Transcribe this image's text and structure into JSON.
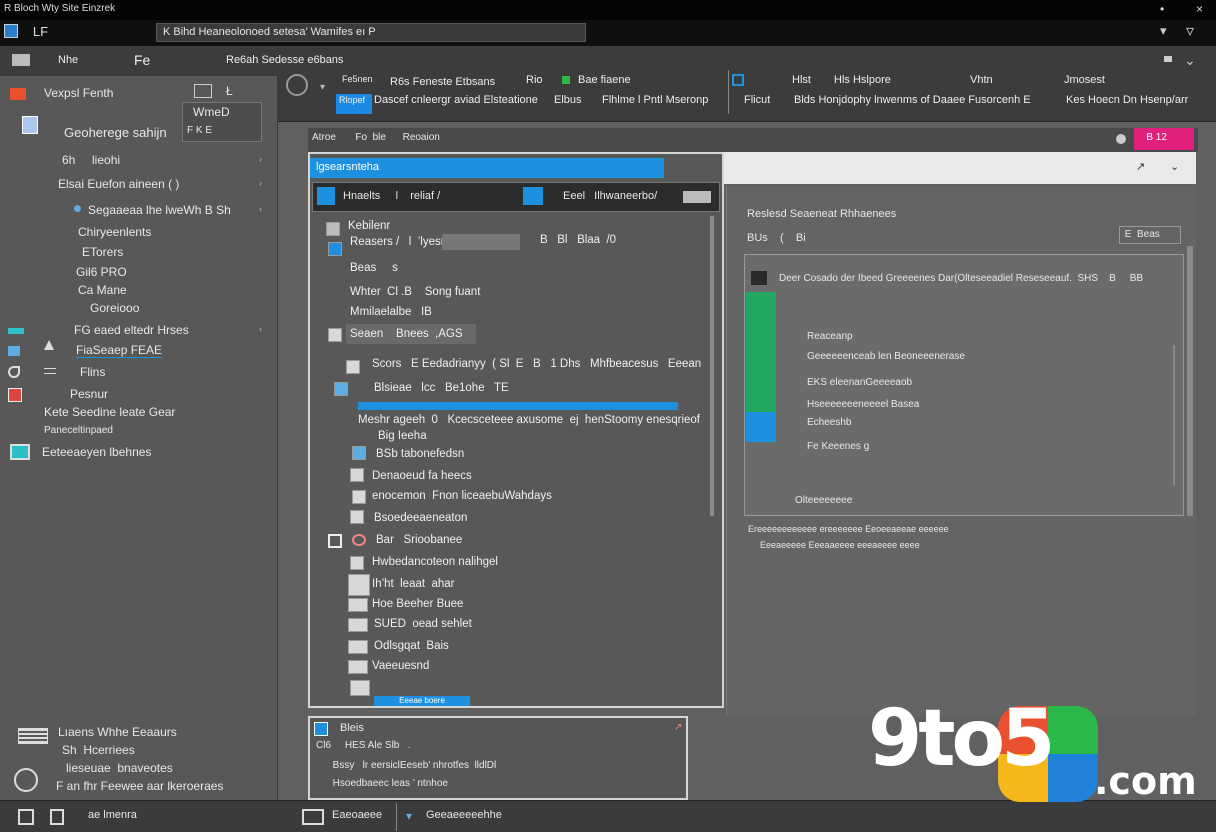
{
  "titlebar": {
    "title": "R Bloch Wty  Site Einzrek",
    "min": "•",
    "close": "×"
  },
  "topbar": {
    "left_label": "   LF",
    "address": "K Bihd  Heaneolonoed setesa’ Wamifes eı P",
    "right_glyph": "▿"
  },
  "ribbon": {
    "items": [
      "Nhe",
      "Fe",
      "Re6ah Sedesse e6bans",
      "Fe5nen",
      "R6s Feneste Etbsans",
      "Rio",
      "Bae fiaene",
      "Hlst",
      "Hls Hslpore",
      "Vhtn",
      "Jmosest"
    ],
    "items2": [
      "Rlopef",
      "Dascef cnleergr aviad Elsteatione",
      "Elbus",
      "Flhlme l Pntl Mseronp",
      "Flicut",
      "Blds Honjdophy lnwenms of Daaee Fusorcenh E",
      "Kes Hoecn Dn Hsenp/arr"
    ]
  },
  "sidebar": {
    "search_value": "Vexpsl Fenth",
    "mode": "WmeD",
    "items": [
      {
        "label": "Geoherege sahijn",
        "tag": "F K E"
      },
      {
        "label": "6h     lieohi"
      },
      {
        "label": "Elsai Euefon aineen ( )"
      },
      {
        "label": "Segaaeaa lhe lweWh B Sh"
      },
      {
        "label": "Chiryeenlents"
      },
      {
        "label": "ETorers"
      },
      {
        "label": "Gil6 PRO"
      },
      {
        "label": "Ca Mane"
      },
      {
        "label": "Goreiooo"
      },
      {
        "label": "FG eaed eltedr Hrses"
      },
      {
        "label": "FiaSeaep FEAE"
      },
      {
        "label": "Flins"
      },
      {
        "label": "Pesnur"
      },
      {
        "label": "Kete Seedine leate Gear"
      },
      {
        "label": "Paneceltinpaed"
      },
      {
        "label": "Eeteeaeyen lbehnes"
      }
    ],
    "footer": [
      {
        "label": "Lıaens Whhe Eeaaurs"
      },
      {
        "label": "Sh  Hcerriees"
      },
      {
        "label": "lieseuae  bnaveotes"
      },
      {
        "label": "F an fhr Feewee aar lkeroeraes"
      }
    ]
  },
  "workspace": {
    "tabstrip_label": "Atroe       Fo  ble      Reoaion",
    "tab_badge": "   B 12"
  },
  "dialog": {
    "title": "lgsearsnteha",
    "toolbar": [
      "Hnaelts     l    reliaf /",
      "Eeel   Ilhwaneerbo/"
    ],
    "fields": [
      {
        "label": "Kebilenr"
      },
      {
        "label": "Reasers /   l  ’lyesnasse",
        "value": "B   Bl   Blaa  /0"
      },
      {
        "label": "Beas     s"
      },
      {
        "label": "Whter  Cl .B    Song fuant"
      },
      {
        "label": "Mmilaelalbe   IB"
      },
      {
        "label": "Seaen    Bnees  ,AGS"
      },
      {
        "label": "Scors   E Eedadrianyy  ( Sl  E   B   1 Dhs   Mhfbeacesus   Eeean"
      },
      {
        "label": "Blsieae   lcc   Be1ohe   TE"
      },
      {
        "label": "Meshr ageeh  0   Kcecsceteee axusome  ej  henStoomy enesqrieof"
      },
      {
        "label": "Big Ieeha"
      },
      {
        "label": "BSb tabonefedsn"
      },
      {
        "label": "Denaoeud fa heecs"
      },
      {
        "label": "enocemon  Fnon liceaebuWahdays"
      },
      {
        "label": "Bsoedeeaeneaton"
      },
      {
        "label": "Bar   Srioobanee"
      },
      {
        "label": "Hwbedancoteon nalihgel"
      },
      {
        "label": "Ih’ht  leaat  ahar"
      },
      {
        "label": "Hoe Beeher Buee"
      },
      {
        "label": "SUED  oead sehlet"
      },
      {
        "label": "Odlsgqat  Bais"
      },
      {
        "label": "Vaeeuesnd"
      }
    ],
    "ok": "Eeeae boere"
  },
  "right": {
    "header": "Reslesd Seaeneat Rhhaenees",
    "mode": "BUs    (    Bi",
    "action": " E  Beas",
    "panel_title": "Deer Cosado der Ibeed Greeeenes Dar(Olteseeadiel Reseseeauf.  SHS    B     BB",
    "rows": [
      "Reaceanp",
      "Geeeeeenceab len Beoneeenerase",
      "EKS eleenanGeeeeaob",
      "Hseeeeeeeneeeel Basea",
      "Echeeshb",
      "Fe Keeenes g",
      "Olteeeeeeee"
    ],
    "footer1": "Ereeeeeeeeeeee ereeeeeee Eeoeeaeeae eeeeee",
    "footer2": "Eeeaeeeee Eeeaaeeee eeeaeeee eeee"
  },
  "subdlg": {
    "title": "Bleis",
    "row1": "Cl6     HES Ale Slb   .",
    "row2": "      Bssy   lr eersiclEeseb’ nhrotfes  lldlDl",
    "row3": "      Hsoedbaeec leas ’ ntnhoe "
  },
  "statusbar": {
    "left": "ae lmenra",
    "mid": "Eaeoaeee",
    "right": "Geeaeeeeehhe"
  },
  "watermark": {
    "brand": "9to5",
    "suffix": ".com",
    "colors": [
      "#e8502e",
      "#2bb84b",
      "#1f82d8",
      "#f5b81a"
    ]
  }
}
